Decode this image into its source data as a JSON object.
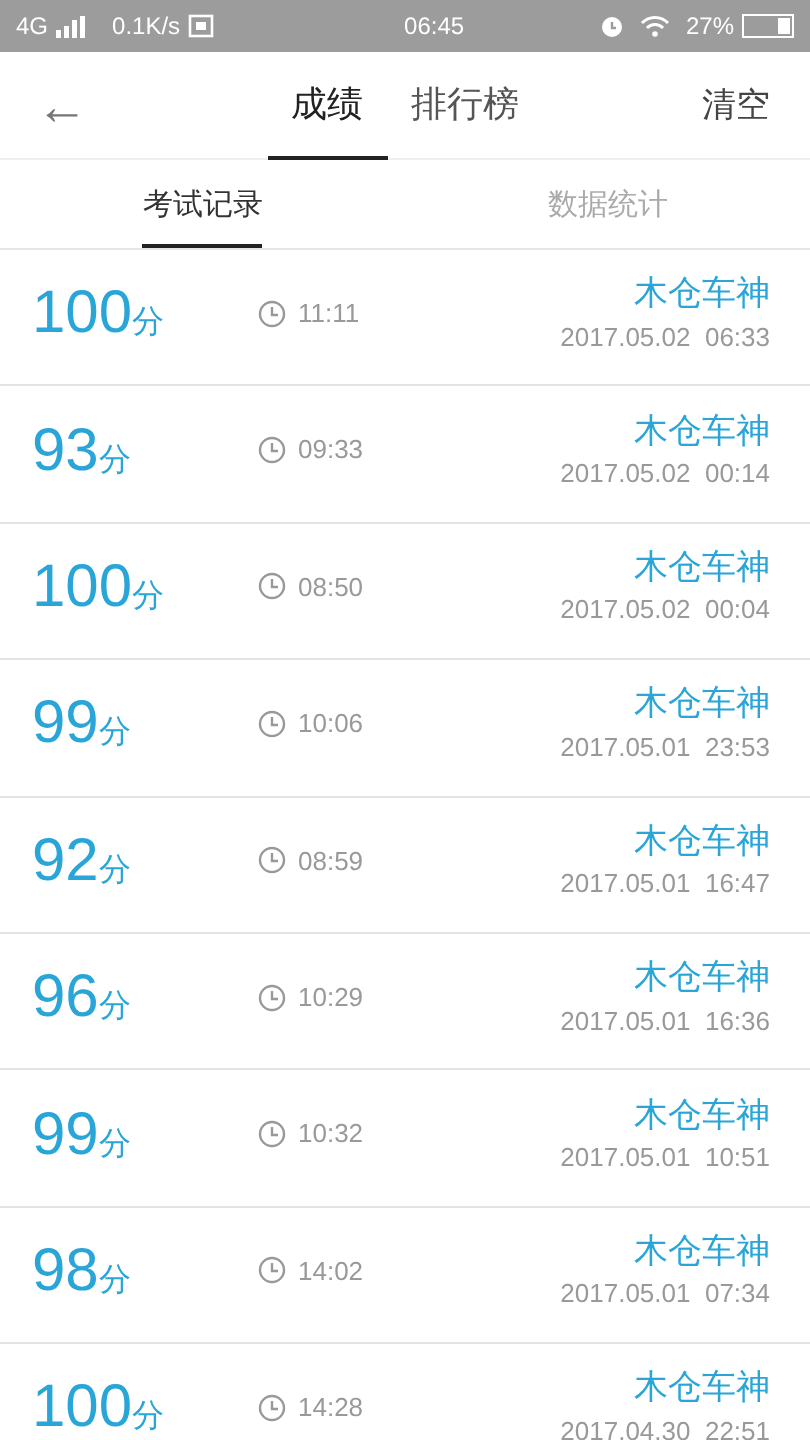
{
  "status_bar": {
    "network": "4G",
    "speed": "0.1K/s",
    "time": "06:45",
    "battery": "27%"
  },
  "header": {
    "back": "←",
    "tabs": [
      {
        "label": "成绩",
        "selected": true
      },
      {
        "label": "排行榜",
        "selected": false
      }
    ],
    "action": "清空"
  },
  "subtabs": [
    {
      "label": "考试记录",
      "selected": true
    },
    {
      "label": "数据统计",
      "selected": false
    }
  ],
  "records": [
    {
      "score": "100",
      "unit": "分",
      "duration": "11:11",
      "name": "木仓车神",
      "date": "2017.05.02  06:33"
    },
    {
      "score": "93",
      "unit": "分",
      "duration": "09:33",
      "name": "木仓车神",
      "date": "2017.05.02  00:14"
    },
    {
      "score": "100",
      "unit": "分",
      "duration": "08:50",
      "name": "木仓车神",
      "date": "2017.05.02  00:04"
    },
    {
      "score": "99",
      "unit": "分",
      "duration": "10:06",
      "name": "木仓车神",
      "date": "2017.05.01  23:53"
    },
    {
      "score": "92",
      "unit": "分",
      "duration": "08:59",
      "name": "木仓车神",
      "date": "2017.05.01  16:47"
    },
    {
      "score": "96",
      "unit": "分",
      "duration": "10:29",
      "name": "木仓车神",
      "date": "2017.05.01  16:36"
    },
    {
      "score": "99",
      "unit": "分",
      "duration": "10:32",
      "name": "木仓车神",
      "date": "2017.05.01  10:51"
    },
    {
      "score": "98",
      "unit": "分",
      "duration": "14:02",
      "name": "木仓车神",
      "date": "2017.05.01  07:34"
    },
    {
      "score": "100",
      "unit": "分",
      "duration": "14:28",
      "name": "木仓车神",
      "date": "2017.04.30  22:51"
    }
  ]
}
